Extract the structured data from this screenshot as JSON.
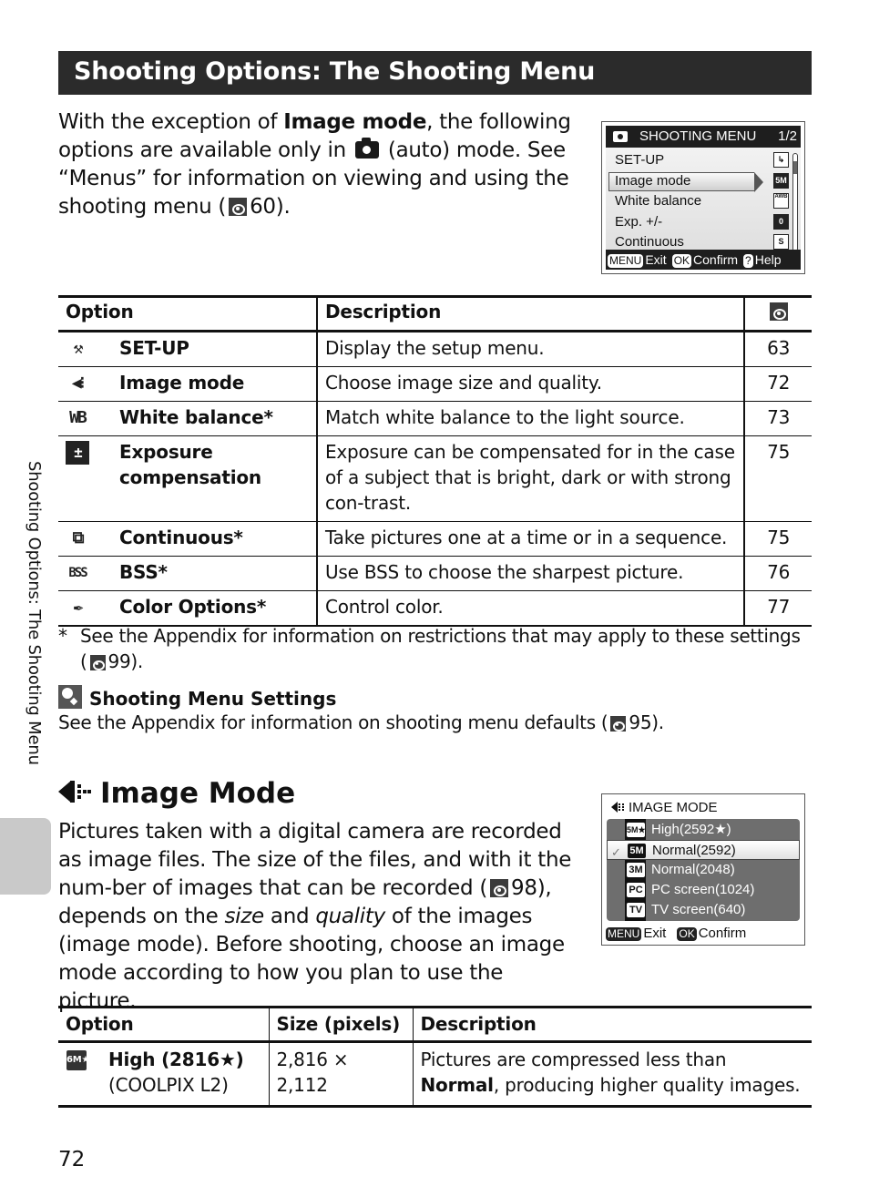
{
  "header": {
    "title": "Shooting Options: The Shooting Menu"
  },
  "intro": {
    "part1": "With the exception of ",
    "bold": "Image mode",
    "part2": ", the following options are available only in ",
    "icon": "camera-auto-icon",
    "part3": " (auto) mode. See “Menus” for information on viewing and using the shooting menu (",
    "ref_page": "60",
    "part4": ")."
  },
  "shooting_menu_screen": {
    "title": "SHOOTING MENU",
    "page": "1/2",
    "items": [
      {
        "label": "SET-UP",
        "icon": "setup-icon",
        "icon_text": "↳"
      },
      {
        "label": "Image mode",
        "icon": "5m-icon",
        "icon_text": "5M",
        "selected": true
      },
      {
        "label": "White balance",
        "icon": "awb-icon",
        "icon_text": "AWB"
      },
      {
        "label": "Exp. +/-",
        "icon": "exposure-zero-icon",
        "icon_text": "0"
      },
      {
        "label": "Continuous",
        "icon": "single-icon",
        "icon_text": "S"
      }
    ],
    "footer": {
      "menu_key": "MENU",
      "exit": "Exit",
      "ok_key": "OK",
      "confirm": "Confirm",
      "help_key": "?",
      "help": "Help"
    }
  },
  "options_table": {
    "headers": {
      "option": "Option",
      "description": "Description",
      "page_icon": "reference-icon"
    },
    "rows": [
      {
        "icon": "wrench-icon",
        "icon_text": "⚒",
        "option": "SET-UP",
        "description": "Display the setup menu.",
        "page": "63"
      },
      {
        "icon": "image-mode-icon",
        "icon_text": "◀⁝",
        "option": "Image mode",
        "description": "Choose image size and quality.",
        "page": "72"
      },
      {
        "icon": "white-balance-icon",
        "icon_text": "WB",
        "option": "White balance*",
        "description": "Match white balance to the light source.",
        "page": "73"
      },
      {
        "icon": "exposure-compensation-icon",
        "icon_text": "±",
        "option": "Exposure compensation",
        "description": "Exposure can be compensated for in the case of a subject that is bright, dark or with strong con-trast.",
        "page": "75"
      },
      {
        "icon": "continuous-icon",
        "icon_text": "⧉",
        "option": "Continuous*",
        "description": "Take pictures one at a time or in a sequence.",
        "page": "75"
      },
      {
        "icon": "bss-icon",
        "icon_text": "BSS",
        "option": "BSS*",
        "description": "Use BSS to choose the sharpest picture.",
        "page": "76"
      },
      {
        "icon": "color-options-icon",
        "icon_text": "✒",
        "option": "Color Options*",
        "description": "Control color.",
        "page": "77"
      }
    ]
  },
  "footnote": {
    "marker": "*",
    "line1": "See the Appendix for information on restrictions that may apply to these settings",
    "ref_open": "(",
    "ref_page": "99",
    "ref_close": ")."
  },
  "tip": {
    "title": "Shooting Menu Settings",
    "text_before": "See the Appendix for information on shooting menu defaults (",
    "ref_page": "95",
    "text_after": ")."
  },
  "image_mode_section": {
    "title": "Image Mode",
    "body": {
      "p1": "Pictures taken with a digital camera are recorded as image files. The size of the files, and with it the num-ber of images that can be recorded (",
      "ref_page": "98",
      "p2": "), depends on the ",
      "size_word": "size",
      "p3": " and ",
      "quality_word": "quality",
      "p4": " of the images (image mode). Before shooting, choose an image mode according to how you plan to use the picture."
    }
  },
  "image_mode_screen": {
    "title": "IMAGE MODE",
    "items": [
      {
        "badge": "5M★",
        "label": "High(2592★)"
      },
      {
        "badge": "5M",
        "label": "Normal(2592)",
        "selected": true
      },
      {
        "badge": "3M",
        "label": "Normal(2048)"
      },
      {
        "badge": "PC",
        "label": "PC screen(1024)"
      },
      {
        "badge": "TV",
        "label": "TV screen(640)"
      }
    ],
    "footer": {
      "menu_key": "MENU",
      "exit": "Exit",
      "ok_key": "OK",
      "confirm": "Confirm"
    }
  },
  "image_mode_table": {
    "headers": {
      "option": "Option",
      "size": "Size (pixels)",
      "description": "Description"
    },
    "rows": [
      {
        "icon": "6m-high-icon",
        "icon_text": "6M★",
        "option": "High (2816★)",
        "option_note": "(COOLPIX L2)",
        "size": "2,816 × 2,112",
        "desc_before": "Pictures are compressed less than ",
        "desc_bold": "Normal",
        "desc_after": ", producing higher quality images."
      }
    ]
  },
  "side_tab": {
    "text": "Shooting Options: The Shooting Menu"
  },
  "page_number": "72"
}
